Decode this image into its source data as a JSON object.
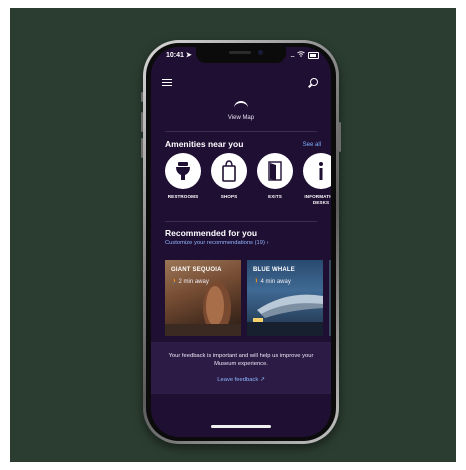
{
  "status_bar": {
    "time": "10:41",
    "location_arrow": "location-arrow-icon",
    "signal": "....",
    "wifi": "wifi-icon",
    "battery": "battery-icon"
  },
  "header": {
    "menu_icon": "hamburger-menu-icon",
    "search_icon": "search-icon"
  },
  "map": {
    "label": "View Map"
  },
  "amenities": {
    "title": "Amenities near you",
    "see_all": "See all",
    "items": [
      {
        "label": "RESTROOMS",
        "icon": "restroom-icon"
      },
      {
        "label": "SHOPS",
        "icon": "shopping-bag-icon"
      },
      {
        "label": "EXITS",
        "icon": "exit-door-icon"
      },
      {
        "label": "INFORMATION DESKS",
        "icon": "info-icon"
      }
    ]
  },
  "recommended": {
    "title": "Recommended for you",
    "customize_link": "Customize your recommendations (19) ›",
    "cards": [
      {
        "title": "GIANT SEQUOIA",
        "time": "2 min away"
      },
      {
        "title": "BLUE WHALE",
        "time": "4 min away"
      }
    ]
  },
  "feedback": {
    "text": "Your feedback is important and will help us improve your Museum experience.",
    "link": "Leave feedback",
    "link_icon": "external-link-icon"
  },
  "colors": {
    "screen_bg": "#1f0f33",
    "accent_link": "#8fb6ff",
    "page_bg": "#2b3d31"
  }
}
